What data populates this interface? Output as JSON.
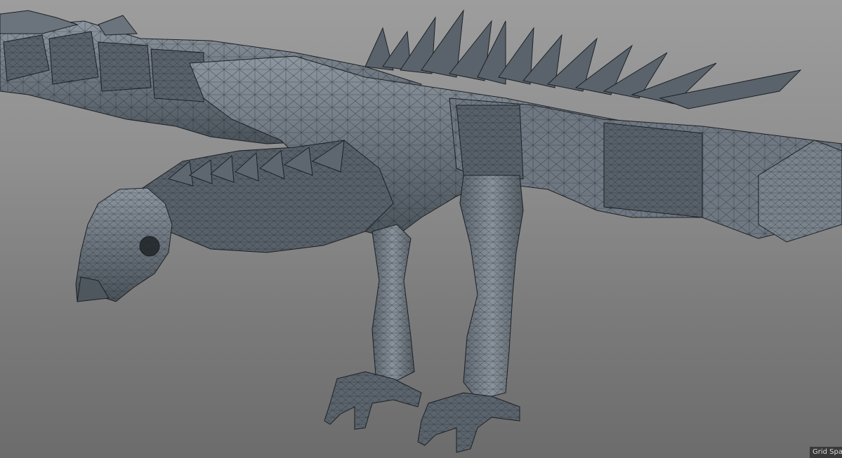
{
  "viewport": {
    "subject": "wireframe-bird-model",
    "colors": {
      "background_top": "#9d9d9d",
      "background_bottom": "#6c6c6c",
      "mesh_fill": "#5d6670",
      "mesh_fill_light": "#8b949d",
      "wire": "#1c2024"
    }
  },
  "status": {
    "grid_spacing_label": "Grid Spac"
  }
}
